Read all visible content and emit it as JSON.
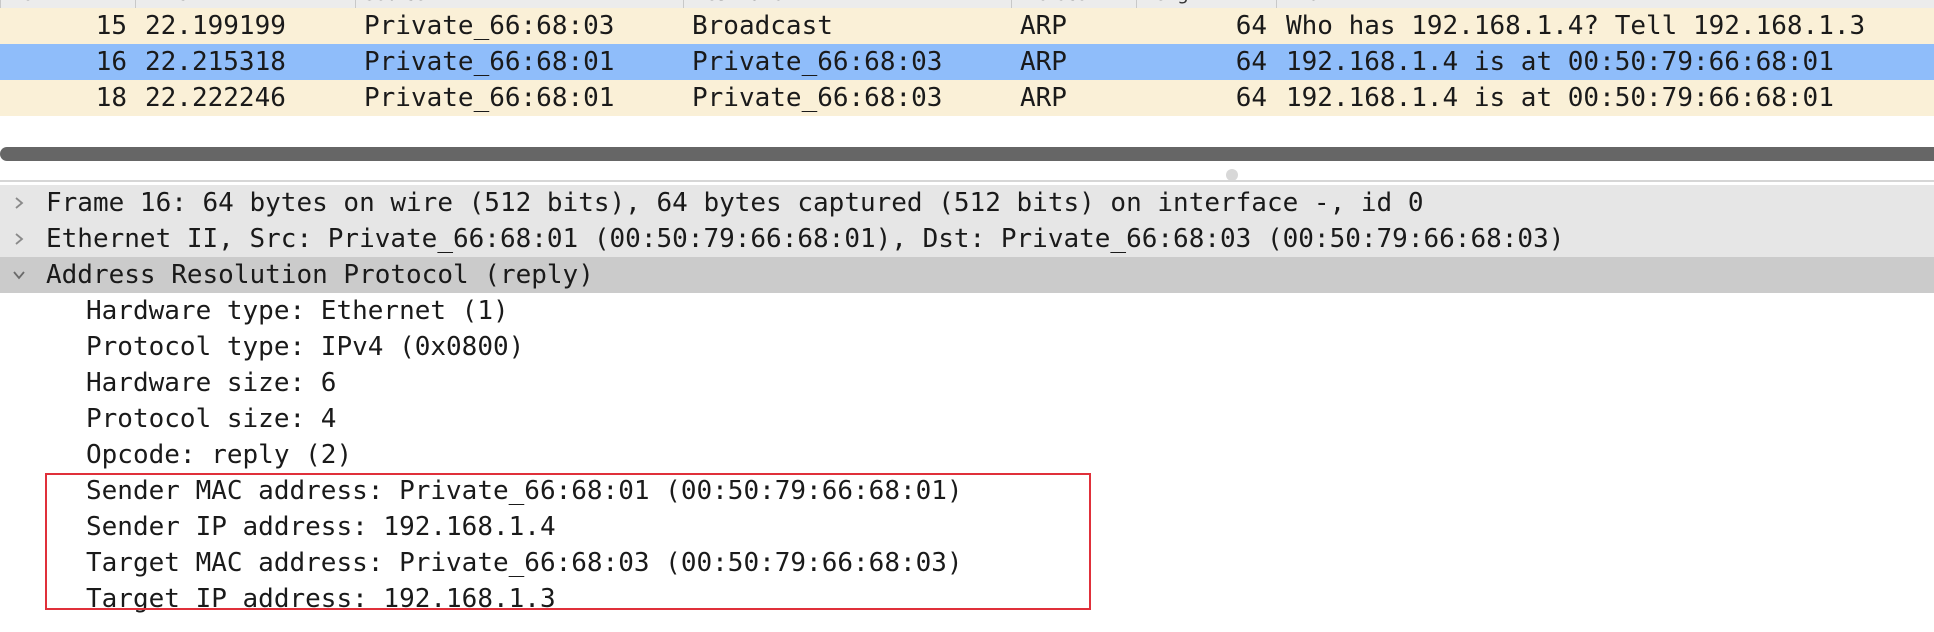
{
  "packets": [
    {
      "no": "15",
      "time": "22.199199",
      "source": "Private_66:68:03",
      "destination": "Broadcast",
      "protocol": "ARP",
      "length": "64",
      "info": "Who has 192.168.1.4? Tell 192.168.1.3"
    },
    {
      "no": "16",
      "time": "22.215318",
      "source": "Private_66:68:01",
      "destination": "Private_66:68:03",
      "protocol": "ARP",
      "length": "64",
      "info": "192.168.1.4 is at 00:50:79:66:68:01"
    },
    {
      "no": "18",
      "time": "22.222246",
      "source": "Private_66:68:01",
      "destination": "Private_66:68:03",
      "protocol": "ARP",
      "length": "64",
      "info": "192.168.1.4 is at 00:50:79:66:68:01"
    }
  ],
  "selected_packet_no": "16",
  "details": {
    "frame": "Frame 16: 64 bytes on wire (512 bits), 64 bytes captured (512 bits) on interface -, id 0",
    "ethernet": "Ethernet II, Src: Private_66:68:01 (00:50:79:66:68:01), Dst: Private_66:68:03 (00:50:79:66:68:03)",
    "arp": "Address Resolution Protocol (reply)",
    "arp_fields": [
      "Hardware type: Ethernet (1)",
      "Protocol type: IPv4 (0x0800)",
      "Hardware size: 6",
      "Protocol size: 4",
      "Opcode: reply (2)",
      "Sender MAC address: Private_66:68:01 (00:50:79:66:68:01)",
      "Sender IP address: 192.168.1.4",
      "Target MAC address: Private_66:68:03 (00:50:79:66:68:03)",
      "Target IP address: 192.168.1.3"
    ]
  },
  "colors": {
    "arp_row": "#faf0d7",
    "selected_row": "#8fbdfa",
    "highlight_border": "#e0303a"
  }
}
